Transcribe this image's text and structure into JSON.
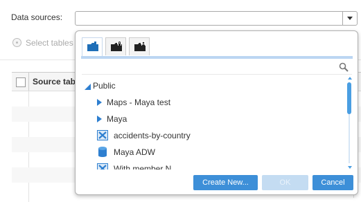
{
  "form": {
    "data_sources_label": "Data sources:",
    "data_sources_value": "",
    "select_tables_label": "Select tables"
  },
  "table": {
    "header_source": "Source tabl"
  },
  "popup": {
    "tabs": [
      {
        "icon": "folder-icon",
        "active": true
      },
      {
        "icon": "folder-lock-icon",
        "active": false
      },
      {
        "icon": "folder-user-icon",
        "active": false
      }
    ],
    "tree": {
      "root_label": "Public",
      "items": [
        {
          "label": "Maps - Maya test",
          "icon": "expand-arrow-icon"
        },
        {
          "label": "Maya",
          "icon": "expand-arrow-icon"
        },
        {
          "label": "accidents-by-country",
          "icon": "excel-file-icon"
        },
        {
          "label": "Maya ADW",
          "icon": "database-icon"
        },
        {
          "label": "With member N",
          "icon": "excel-file-icon"
        }
      ]
    },
    "buttons": {
      "create_new": "Create New...",
      "ok": "OK",
      "cancel": "Cancel"
    }
  },
  "colors": {
    "accent": "#3d8fd8",
    "accent_light": "#bcd6f2",
    "disabled_button": "#c4dcf2"
  }
}
